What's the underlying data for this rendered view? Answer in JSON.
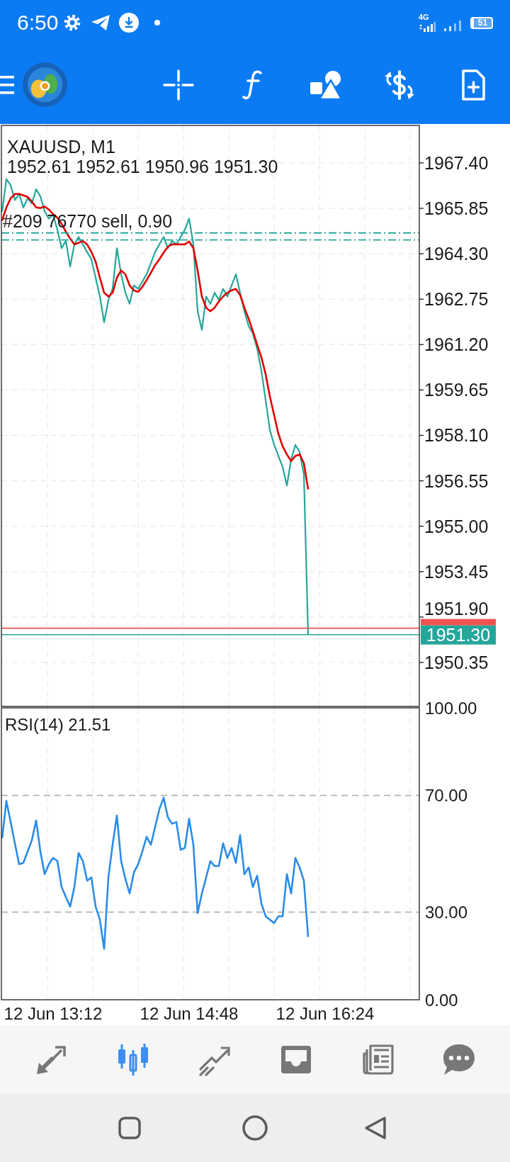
{
  "status_bar": {
    "time": "6:50",
    "network": "4G",
    "battery": "51"
  },
  "chart": {
    "ohlc": "1952.61 1952.61 1950.96 1951.30",
    "chart_data": {
      "type": "line",
      "title": "XAUUSD, M1",
      "grid": true,
      "ylim": [
        1948.85,
        1968.68
      ],
      "yticks": [
        {
          "value": 1967.4,
          "label": "1967.40"
        },
        {
          "value": 1965.85,
          "label": "1965.85"
        },
        {
          "value": 1964.3,
          "label": "1964.30"
        },
        {
          "value": 1962.75,
          "label": "1962.75"
        },
        {
          "value": 1961.2,
          "label": "1961.20"
        },
        {
          "value": 1959.65,
          "label": "1959.65"
        },
        {
          "value": 1958.1,
          "label": "1958.10"
        },
        {
          "value": 1956.55,
          "label": "1956.55"
        },
        {
          "value": 1955,
          "label": "1955.00"
        },
        {
          "value": 1953.45,
          "label": "1953.45"
        },
        {
          "value": 1951.9,
          "label": "1951.90"
        },
        {
          "value": 1950.35,
          "label": "1950.35"
        }
      ],
      "series": [
        {
          "color": "#26a69a",
          "values": [
            1965.73,
            1966.85,
            1966.64,
            1966.13,
            1966.34,
            1965.88,
            1966.19,
            1966.01,
            1966.5,
            1966.26,
            1965.75,
            1965.5,
            1965.63,
            1965.12,
            1964.49,
            1964.74,
            1963.86,
            1964.62,
            1964.87,
            1964.62,
            1964.36,
            1964.11,
            1963.48,
            1962.84,
            1961.96,
            1962.72,
            1963.1,
            1964.49,
            1963.6,
            1962.97,
            1962.59,
            1963.22,
            1963.1,
            1963.35,
            1963.6,
            1963.98,
            1964.36,
            1964.62,
            1964.87,
            1964.49,
            1964.74,
            1964.62,
            1964.87,
            1965.12,
            1965.5,
            1964.62,
            1962.34,
            1961.7,
            1962.84,
            1962.59,
            1962.97,
            1962.72,
            1963.1,
            1962.84,
            1963.22,
            1963.6,
            1962.97,
            1962.34,
            1961.83,
            1961.58,
            1961.07,
            1960.31,
            1959.3,
            1958.29,
            1957.78,
            1957.4,
            1957.02,
            1956.39,
            1957.27,
            1957.78,
            1957.53,
            1956.77,
            1951.3,
            null,
            null,
            null,
            null,
            null,
            null,
            null,
            null,
            null,
            null,
            null,
            null,
            null,
            null,
            null,
            null,
            null,
            null,
            null,
            null,
            null,
            null,
            null,
            null,
            null,
            null
          ]
        },
        {
          "color": "#e00000",
          "values": [
            1965.43,
            1965.88,
            1966.19,
            1966.34,
            1966.34,
            1966.29,
            1966.24,
            1966.08,
            1965.88,
            1965.86,
            1965.91,
            1965.81,
            1965.65,
            1965.53,
            1965.32,
            1965.05,
            1964.82,
            1964.62,
            1964.67,
            1964.74,
            1964.62,
            1964.36,
            1964.03,
            1963.48,
            1962.97,
            1962.84,
            1962.97,
            1963.48,
            1963.73,
            1963.6,
            1963.22,
            1963.05,
            1963,
            1963.17,
            1963.4,
            1963.65,
            1963.91,
            1964.11,
            1964.34,
            1964.54,
            1964.62,
            1964.62,
            1964.62,
            1964.62,
            1964.72,
            1964.49,
            1963.73,
            1962.84,
            1962.46,
            1962.34,
            1962.46,
            1962.67,
            1962.84,
            1962.97,
            1963.05,
            1963.1,
            1962.89,
            1962.46,
            1962.08,
            1961.65,
            1961.2,
            1960.77,
            1960.19,
            1959.43,
            1958.79,
            1958.16,
            1957.73,
            1957.45,
            1957.22,
            1957.4,
            1957.45,
            1957.15,
            1956.26,
            null,
            null,
            null,
            null,
            null,
            null,
            null,
            null,
            null,
            null,
            null,
            null,
            null,
            null,
            null,
            null,
            null,
            null,
            null,
            null,
            null,
            null,
            null,
            null,
            null,
            null
          ]
        }
      ],
      "ref_lines": [
        {
          "axis": "y",
          "value": 1965.01,
          "color": "#26a69a",
          "line_style": "dashdot",
          "label": "#209 76770 sell, 0.90"
        },
        {
          "axis": "y",
          "value": 1964.77,
          "color": "#26a69a",
          "line_style": "dashdot"
        },
        {
          "axis": "y",
          "value": 1951.52,
          "color": "#ef5350",
          "line_style": "solid"
        },
        {
          "axis": "y",
          "value": 1951.3,
          "color": "#26a69a",
          "line_style": "solid",
          "label": "1951.30"
        }
      ]
    }
  },
  "indicator": {
    "chart_data": {
      "type": "line",
      "title": "RSI(14) 21.51",
      "grid": true,
      "categories": [
        null,
        null,
        null,
        null,
        null,
        null,
        null,
        null,
        null,
        null,
        null,
        null,
        "12 Jun 13:12",
        null,
        null,
        null,
        null,
        null,
        null,
        null,
        null,
        null,
        null,
        null,
        null,
        null,
        null,
        null,
        null,
        null,
        null,
        null,
        null,
        null,
        null,
        null,
        null,
        null,
        null,
        null,
        null,
        null,
        null,
        null,
        "12 Jun 14:48",
        null,
        null,
        null,
        null,
        null,
        null,
        null,
        null,
        null,
        null,
        null,
        null,
        null,
        null,
        null,
        null,
        null,
        null,
        null,
        null,
        null,
        null,
        null,
        null,
        null,
        null,
        null,
        null,
        null,
        null,
        null,
        "12 Jun 16:24",
        null,
        null,
        null,
        null,
        null,
        null,
        null,
        null,
        null,
        null,
        null,
        null,
        null,
        null,
        null,
        null,
        null,
        null,
        null,
        null,
        null,
        null
      ],
      "ylim": [
        0,
        100
      ],
      "yticks": [
        {
          "value": 100,
          "label": "100.00"
        },
        {
          "value": 70,
          "label": "70.00"
        },
        {
          "value": 30,
          "label": "30.00"
        },
        {
          "value": 0,
          "label": "0.00"
        }
      ],
      "series": [
        {
          "color": "#2a8ce8",
          "values": [
            55.3,
            68.1,
            60.9,
            53.6,
            46.4,
            46.9,
            50.8,
            54.7,
            61.4,
            50.8,
            43,
            46.4,
            48.6,
            47.5,
            38.6,
            35.2,
            31.9,
            38.6,
            50.3,
            47.5,
            40.8,
            41.9,
            31.9,
            27.4,
            17.4,
            41.9,
            53.1,
            63.1,
            47.5,
            41.4,
            36.4,
            43.6,
            46.4,
            50.8,
            55.8,
            53.1,
            59.2,
            65.3,
            69.2,
            62.5,
            60.3,
            60.9,
            51.4,
            52,
            62,
            53.1,
            29.7,
            36.4,
            41.9,
            47.5,
            45.8,
            45.8,
            53.6,
            48.6,
            52,
            46.9,
            56.4,
            43,
            45.3,
            38.6,
            42.5,
            33,
            28.6,
            27.4,
            26.3,
            28.6,
            28.6,
            43,
            36.4,
            48.6,
            45.3,
            40.8,
            21.5,
            null,
            null,
            null,
            null,
            null,
            null,
            null,
            null,
            null,
            null,
            null,
            null,
            null,
            null,
            null,
            null,
            null,
            null,
            null,
            null,
            null,
            null,
            null,
            null,
            null,
            null
          ]
        }
      ],
      "ref_lines": [
        {
          "axis": "y",
          "value": 70,
          "color": "#b4b4b4",
          "line_style": "dashed"
        },
        {
          "axis": "y",
          "value": 30,
          "color": "#b4b4b4",
          "line_style": "dashed"
        }
      ]
    }
  },
  "bottom_nav": [
    {
      "selected": false
    },
    {
      "selected": true
    },
    {
      "selected": false
    },
    {
      "selected": false
    },
    {
      "selected": false
    },
    {
      "selected": false
    }
  ]
}
